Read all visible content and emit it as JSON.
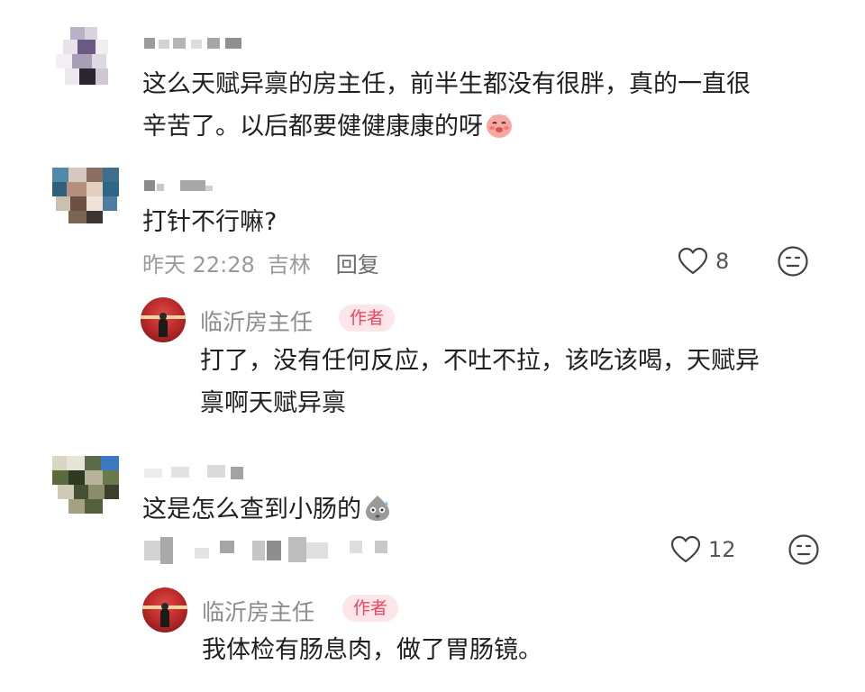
{
  "comments": [
    {
      "text_lines": [
        "这么天赋异禀的房主任，前半生都没有很胖，真的一直很",
        "辛苦了。以后都要健健康康的呀"
      ],
      "emoji": "blushing-face-emoji"
    },
    {
      "text": "打针不行嘛?",
      "time": "昨天 22:28",
      "location": "吉林",
      "reply_label": "回复",
      "likes": "8",
      "reply": {
        "author": "临沂房主任",
        "badge": "作者",
        "text_lines": [
          "打了，没有任何反应，不吐不拉，该吃该喝，天赋异",
          "禀啊天赋异禀"
        ]
      }
    },
    {
      "text": "这是怎么查到小肠的",
      "emoji": "sweating-face-emoji",
      "likes": "12",
      "reply": {
        "author": "临沂房主任",
        "badge": "作者",
        "text_lines": [
          "我体检有肠息肉，做了胃肠镜。"
        ]
      }
    }
  ],
  "icons": {
    "like": "heart-outline-icon",
    "react": "smile-face-icon"
  },
  "colors": {
    "badge_bg": "#fde6ea",
    "badge_text": "#f0445f",
    "meta_text": "#9a9a9a"
  }
}
